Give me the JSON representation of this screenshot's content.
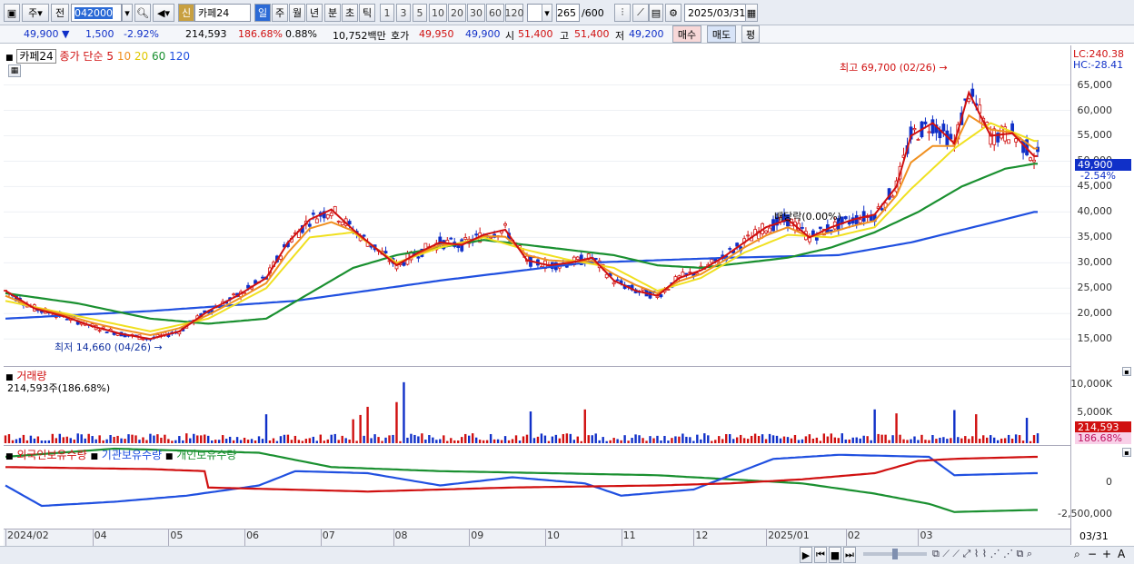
{
  "toolbar": {
    "period_type": "주",
    "prev_label": "전",
    "code": "042000",
    "new_badge": "신",
    "name": "카페24",
    "modes": [
      "일",
      "주",
      "월",
      "년",
      "분",
      "초",
      "틱"
    ],
    "intervals": [
      "1",
      "3",
      "5",
      "10",
      "20",
      "30",
      "60",
      "120"
    ],
    "count": "265",
    "count_max": "/600",
    "date": "2025/03/31"
  },
  "quote": {
    "price": "49,900",
    "change": "1,500",
    "change_pct": "-2.92%",
    "volume": "214,593",
    "vol_ratio": "186.68%",
    "turnover_pct": "0.88%",
    "amount": "10,752백만",
    "ask_label": "호가",
    "ask": "49,950",
    "bid": "49,900",
    "open_label": "시",
    "open": "51,400",
    "high_label": "고",
    "high": "51,400",
    "low_label": "저",
    "low": "49,200",
    "buy_label": "매수",
    "sell_label": "매도",
    "eval_label": "평"
  },
  "legend": {
    "name": "카페24",
    "price_label": "종가 단순",
    "ma": [
      "5",
      "10",
      "20",
      "60",
      "120"
    ],
    "ma_colors": [
      "#d01010",
      "#f09020",
      "#f0e020",
      "#1a9030",
      "#2050e0"
    ],
    "volume_title": "거래량",
    "volume_value": "214,593주(186.68%)",
    "holdings": [
      "외국인보유수량",
      "기관보유수량",
      "개인보유수량"
    ]
  },
  "annotations": {
    "high": "최고 69,700 (02/26)",
    "low": "최저 14,660 (04/26)",
    "dividend": "배당락(0.00%)"
  },
  "yaxis": {
    "lc": "LC:240.38",
    "hc": "HC:-28.41",
    "price_ticks": [
      "65,000",
      "60,000",
      "55,000",
      "50,000",
      "45,000",
      "40,000",
      "35,000",
      "30,000",
      "25,000",
      "20,000",
      "15,000"
    ],
    "current": "49,900",
    "current_pct": "-2.54%",
    "vol_ticks": [
      "10,000K",
      "5,000K"
    ],
    "vol_current": "214,593",
    "vol_pct": "186.68%",
    "hold_ticks": [
      "0",
      "-2,500,000"
    ]
  },
  "xaxis": [
    "2024/02",
    "04",
    "05",
    "06",
    "07",
    "08",
    "09",
    "10",
    "11",
    "12",
    "2025/01",
    "02",
    "03"
  ],
  "xaxis_end": "03/31",
  "chart_data": {
    "type": "line",
    "ylim": [
      12000,
      71000
    ],
    "high": 69700,
    "low": 14660,
    "ma5": [
      [
        0,
        24500
      ],
      [
        8,
        21000
      ],
      [
        16,
        19500
      ],
      [
        24,
        17500
      ],
      [
        32,
        16000
      ],
      [
        40,
        15000
      ],
      [
        48,
        16500
      ],
      [
        56,
        20500
      ],
      [
        64,
        23500
      ],
      [
        72,
        27000
      ],
      [
        78,
        34000
      ],
      [
        84,
        38500
      ],
      [
        90,
        40500
      ],
      [
        96,
        36500
      ],
      [
        102,
        33000
      ],
      [
        108,
        29500
      ],
      [
        114,
        32000
      ],
      [
        120,
        34000
      ],
      [
        126,
        33500
      ],
      [
        132,
        35500
      ],
      [
        138,
        36500
      ],
      [
        144,
        30500
      ],
      [
        150,
        29500
      ],
      [
        156,
        30000
      ],
      [
        162,
        31000
      ],
      [
        168,
        26500
      ],
      [
        174,
        24500
      ],
      [
        180,
        23500
      ],
      [
        186,
        27000
      ],
      [
        192,
        28500
      ],
      [
        198,
        31000
      ],
      [
        204,
        34000
      ],
      [
        210,
        37000
      ],
      [
        216,
        38500
      ],
      [
        222,
        35000
      ],
      [
        228,
        37000
      ],
      [
        234,
        38500
      ],
      [
        240,
        39500
      ],
      [
        246,
        45000
      ],
      [
        250,
        55000
      ],
      [
        256,
        57500
      ],
      [
        262,
        53500
      ],
      [
        266,
        63500
      ],
      [
        272,
        55000
      ],
      [
        278,
        55500
      ],
      [
        284,
        51000
      ]
    ],
    "ma20": [
      [
        0,
        22500
      ],
      [
        20,
        19500
      ],
      [
        40,
        16500
      ],
      [
        56,
        19000
      ],
      [
        72,
        25000
      ],
      [
        84,
        35000
      ],
      [
        96,
        36000
      ],
      [
        108,
        30000
      ],
      [
        120,
        33000
      ],
      [
        132,
        35000
      ],
      [
        144,
        32500
      ],
      [
        156,
        30500
      ],
      [
        168,
        29000
      ],
      [
        180,
        24500
      ],
      [
        192,
        27000
      ],
      [
        204,
        32000
      ],
      [
        216,
        35500
      ],
      [
        228,
        35000
      ],
      [
        240,
        37000
      ],
      [
        250,
        44500
      ],
      [
        262,
        52500
      ],
      [
        272,
        57500
      ],
      [
        284,
        54000
      ]
    ],
    "ma60": [
      [
        0,
        24000
      ],
      [
        20,
        22000
      ],
      [
        40,
        19000
      ],
      [
        56,
        18000
      ],
      [
        72,
        19000
      ],
      [
        84,
        24000
      ],
      [
        96,
        29000
      ],
      [
        108,
        31500
      ],
      [
        120,
        33000
      ],
      [
        132,
        34500
      ],
      [
        144,
        33500
      ],
      [
        156,
        32500
      ],
      [
        168,
        31500
      ],
      [
        180,
        29500
      ],
      [
        192,
        29000
      ],
      [
        204,
        30000
      ],
      [
        216,
        31000
      ],
      [
        228,
        33000
      ],
      [
        240,
        36000
      ],
      [
        252,
        40000
      ],
      [
        264,
        45000
      ],
      [
        276,
        48500
      ],
      [
        284,
        49500
      ]
    ],
    "ma120": [
      [
        0,
        19000
      ],
      [
        40,
        20500
      ],
      [
        80,
        22500
      ],
      [
        120,
        26500
      ],
      [
        160,
        30000
      ],
      [
        200,
        31000
      ],
      [
        230,
        31500
      ],
      [
        250,
        34000
      ],
      [
        270,
        37500
      ],
      [
        284,
        40000
      ]
    ],
    "volume_ylim": [
      0,
      12000000
    ],
    "volume_peak": 11000000,
    "foreign": [
      [
        0,
        0.35
      ],
      [
        40,
        0.3
      ],
      [
        55,
        0.25
      ],
      [
        56,
        -0.15
      ],
      [
        100,
        -0.25
      ],
      [
        140,
        -0.15
      ],
      [
        180,
        -0.1
      ],
      [
        200,
        -0.05
      ],
      [
        220,
        0.05
      ],
      [
        240,
        0.2
      ],
      [
        252,
        0.5
      ],
      [
        262,
        0.55
      ],
      [
        284,
        0.6
      ]
    ],
    "institution": [
      [
        0,
        -0.1
      ],
      [
        10,
        -0.6
      ],
      [
        30,
        -0.5
      ],
      [
        50,
        -0.35
      ],
      [
        70,
        -0.1
      ],
      [
        80,
        0.25
      ],
      [
        100,
        0.2
      ],
      [
        120,
        -0.1
      ],
      [
        140,
        0.1
      ],
      [
        160,
        -0.05
      ],
      [
        170,
        -0.35
      ],
      [
        190,
        -0.2
      ],
      [
        212,
        0.55
      ],
      [
        230,
        0.65
      ],
      [
        255,
        0.6
      ],
      [
        262,
        0.15
      ],
      [
        284,
        0.2
      ]
    ],
    "individual": [
      [
        0,
        0.6
      ],
      [
        30,
        0.8
      ],
      [
        70,
        0.7
      ],
      [
        90,
        0.35
      ],
      [
        120,
        0.25
      ],
      [
        150,
        0.2
      ],
      [
        180,
        0.15
      ],
      [
        200,
        0.05
      ],
      [
        220,
        -0.05
      ],
      [
        240,
        -0.3
      ],
      [
        255,
        -0.55
      ],
      [
        262,
        -0.75
      ],
      [
        284,
        -0.7
      ]
    ]
  }
}
